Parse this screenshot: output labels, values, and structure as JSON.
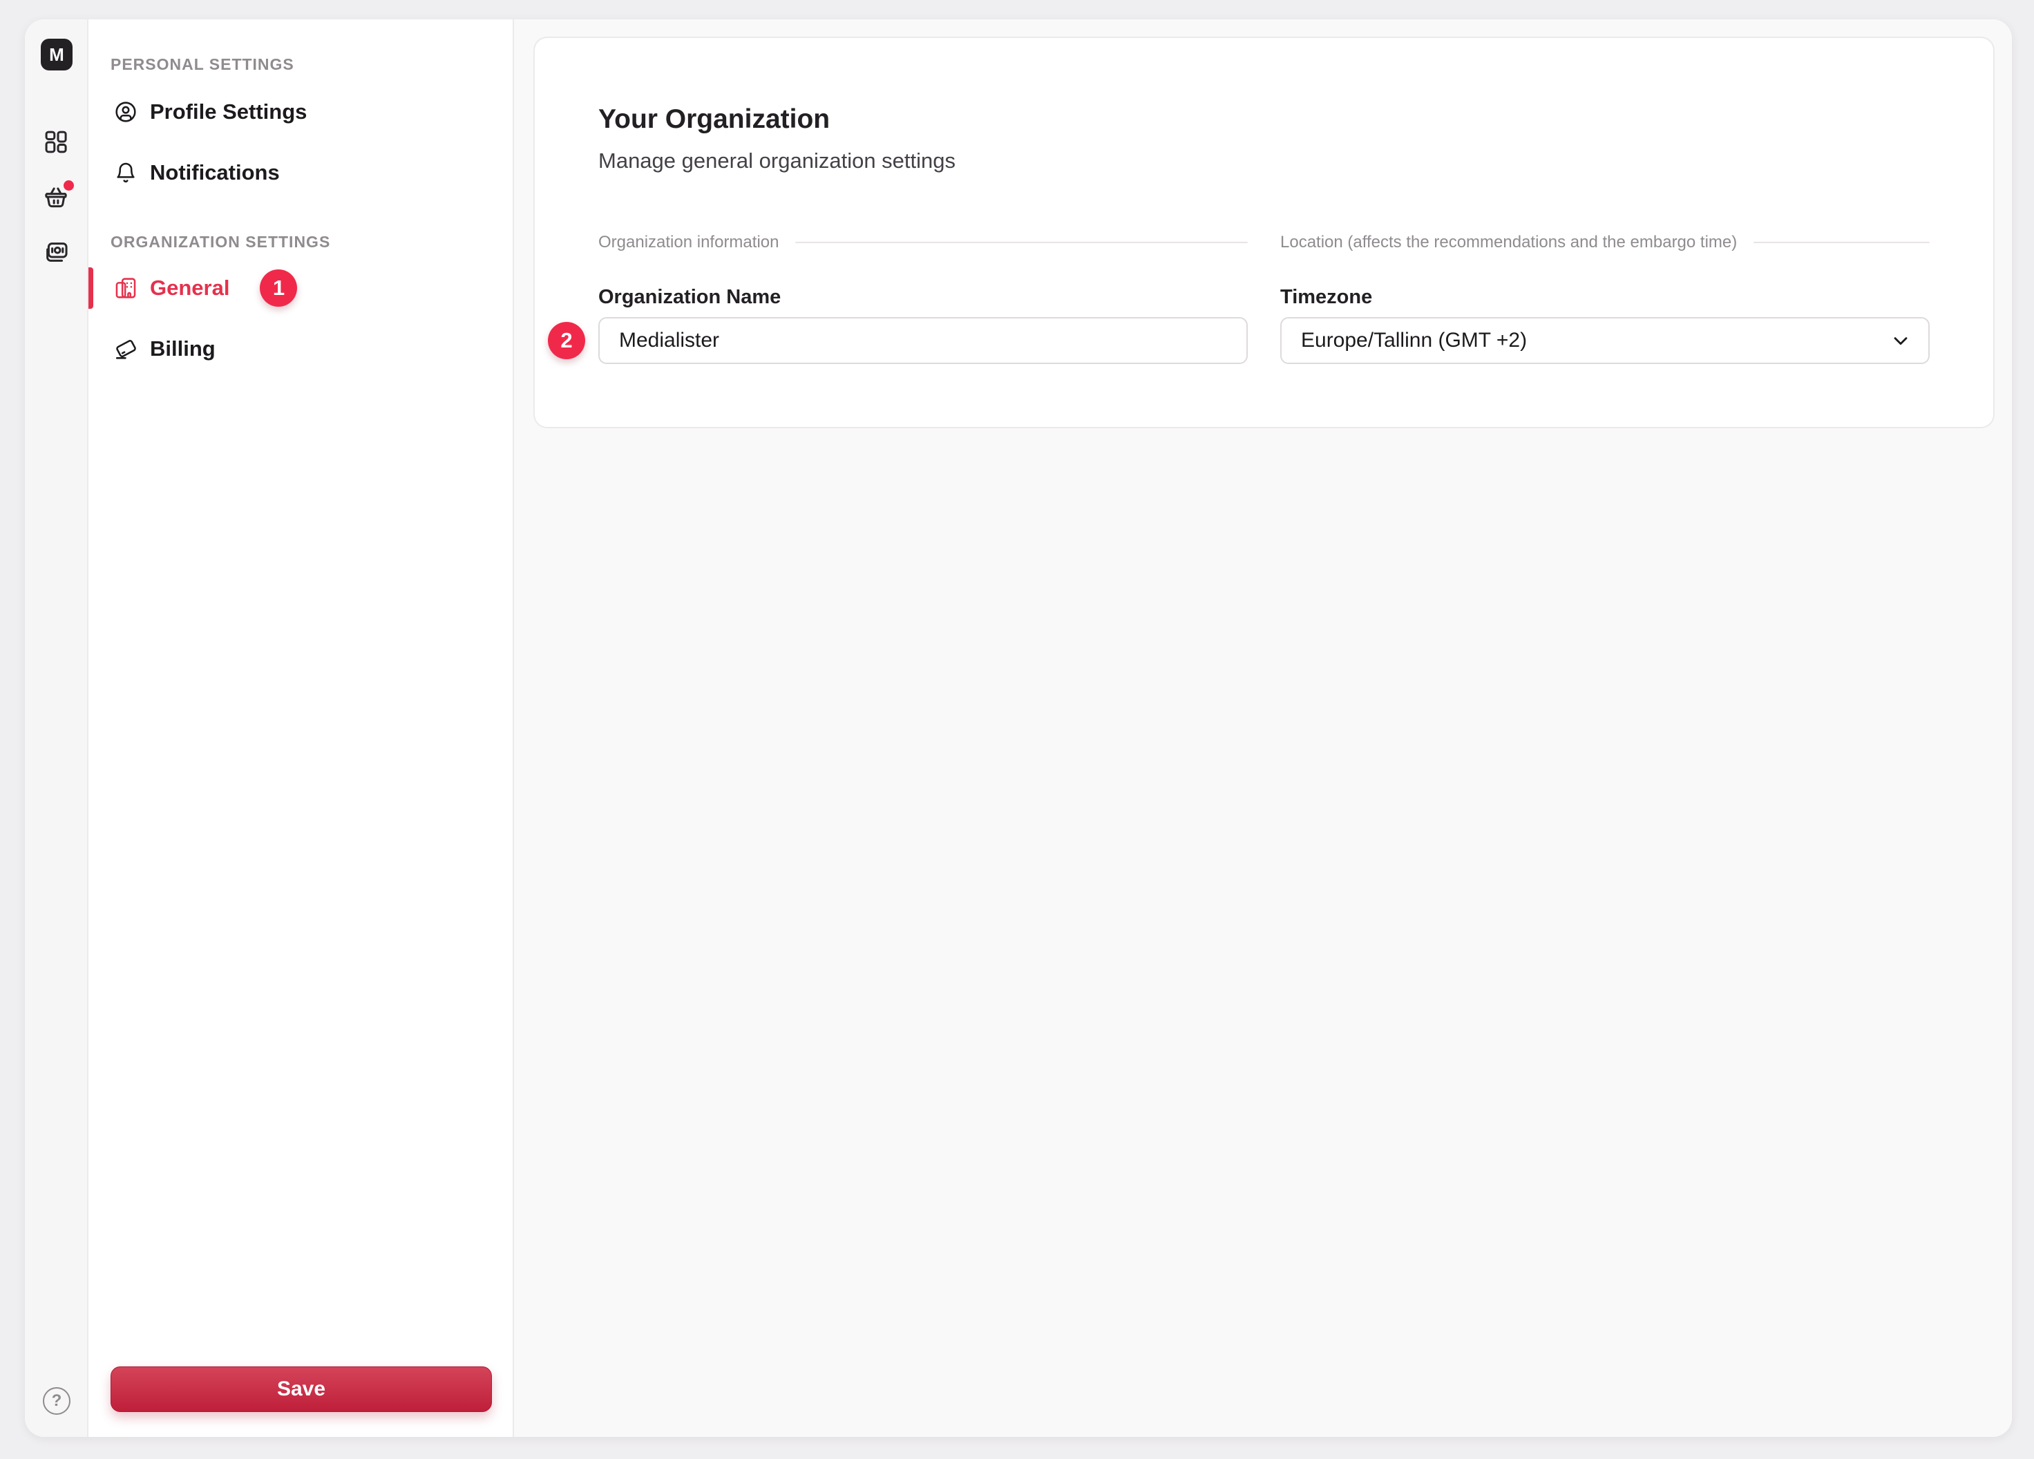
{
  "colors": {
    "accent_red": "#e5314d",
    "badge_red": "#f0294a",
    "save_gradient_top": "#d44459",
    "save_gradient_bottom": "#bf1f3a",
    "page_background": "#efeef0",
    "content_background": "#faf9fa"
  },
  "rail": {
    "logo_text": "M",
    "help_label": "?"
  },
  "sidebar": {
    "sections": [
      {
        "heading": "PERSONAL SETTINGS",
        "items": [
          {
            "label": "Profile Settings"
          },
          {
            "label": "Notifications"
          }
        ]
      },
      {
        "heading": "ORGANIZATION SETTINGS",
        "items": [
          {
            "label": "General",
            "active": true,
            "annotation": "1"
          },
          {
            "label": "Billing"
          }
        ]
      }
    ],
    "save_label": "Save"
  },
  "main": {
    "title": "Your Organization",
    "subtitle": "Manage general organization settings",
    "sections": {
      "org_info_label": "Organization information",
      "location_label": "Location (affects the recommendations and the embargo time)"
    },
    "fields": {
      "org_name": {
        "label": "Organization Name",
        "value": "Medialister",
        "annotation": "2"
      },
      "timezone": {
        "label": "Timezone",
        "value": "Europe/Tallinn (GMT +2)"
      }
    }
  }
}
